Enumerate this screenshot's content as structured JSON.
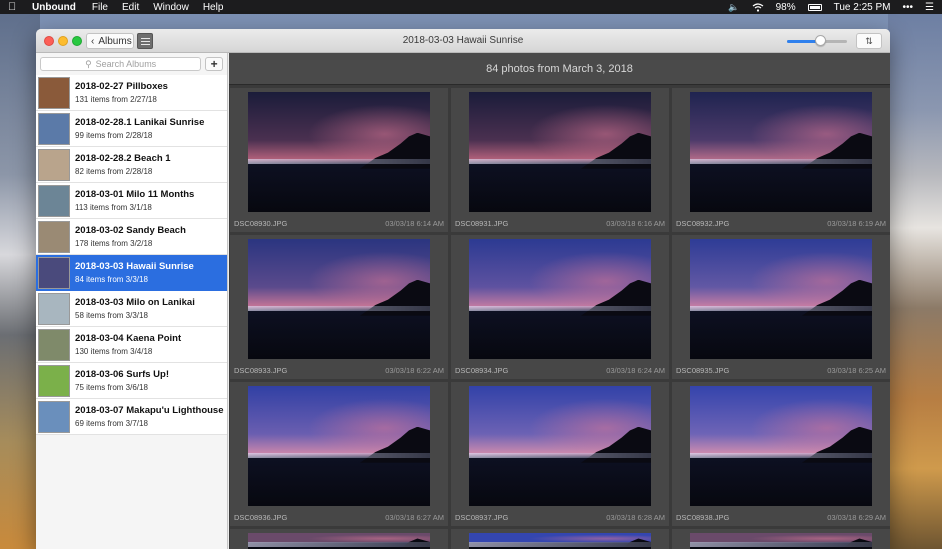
{
  "menubar": {
    "app_name": "Unbound",
    "menus": [
      "File",
      "Edit",
      "Window",
      "Help"
    ],
    "battery": "98%",
    "clock": "Tue 2:25 PM"
  },
  "window": {
    "title": "2018-03-03 Hawaii Sunrise",
    "back_label": "Albums"
  },
  "sidebar": {
    "search_placeholder": "Search Albums",
    "add_label": "+",
    "albums": [
      {
        "name": "2018-02-27 Pillboxes",
        "count": "131 items from 2/27/18",
        "thumb": "#8a5a3a"
      },
      {
        "name": "2018-02-28.1 Lanikai Sunrise",
        "count": "99 items from 2/28/18",
        "thumb": "#5b7aa8"
      },
      {
        "name": "2018-02-28.2 Beach 1",
        "count": "82 items from 2/28/18",
        "thumb": "#b9a48c"
      },
      {
        "name": "2018-03-01 Milo 11 Months",
        "count": "113 items from 3/1/18",
        "thumb": "#6c8596"
      },
      {
        "name": "2018-03-02 Sandy Beach",
        "count": "178 items from 3/2/18",
        "thumb": "#9a8a74"
      },
      {
        "name": "2018-03-03 Hawaii Sunrise",
        "count": "84 items from 3/3/18",
        "thumb": "#4a4a7c"
      },
      {
        "name": "2018-03-03 Milo on Lanikai",
        "count": "58 items from 3/3/18",
        "thumb": "#a8b6bf"
      },
      {
        "name": "2018-03-04 Kaena Point",
        "count": "130 items from 3/4/18",
        "thumb": "#7f8a6a"
      },
      {
        "name": "2018-03-06 Surfs Up!",
        "count": "75 items from 3/6/18",
        "thumb": "#7bb04a"
      },
      {
        "name": "2018-03-07 Makapu'u Lighthouse",
        "count": "69 items from 3/7/18",
        "thumb": "#6a8fbc"
      }
    ]
  },
  "content": {
    "header": "84 photos from March 3, 2018",
    "photos": [
      {
        "file": "DSC08930.JPG",
        "date": "03/03/18 6:14 AM",
        "top": "#1a1c3a",
        "mid": "#4a3050",
        "glow": "#b0607a"
      },
      {
        "file": "DSC08931.JPG",
        "date": "03/03/18 6:16 AM",
        "top": "#1a1c3a",
        "mid": "#4a3050",
        "glow": "#b0607a"
      },
      {
        "file": "DSC08932.JPG",
        "date": "03/03/18 6:19 AM",
        "top": "#1f2450",
        "mid": "#4c3a6a",
        "glow": "#b06a88"
      },
      {
        "file": "DSC08933.JPG",
        "date": "03/03/18 6:22 AM",
        "top": "#2a3580",
        "mid": "#5a4a8c",
        "glow": "#c27496"
      },
      {
        "file": "DSC08934.JPG",
        "date": "03/03/18 6:24 AM",
        "top": "#2c3a92",
        "mid": "#5e52a0",
        "glow": "#c07aa2"
      },
      {
        "file": "DSC08935.JPG",
        "date": "03/03/18 6:25 AM",
        "top": "#2e3c96",
        "mid": "#6258a4",
        "glow": "#c47ca4"
      },
      {
        "file": "DSC08936.JPG",
        "date": "03/03/18 6:27 AM",
        "top": "#3140a4",
        "mid": "#6a5eb0",
        "glow": "#c886ac"
      },
      {
        "file": "DSC08937.JPG",
        "date": "03/03/18 6:28 AM",
        "top": "#3242a8",
        "mid": "#6c62b4",
        "glow": "#ca8aae"
      },
      {
        "file": "DSC08938.JPG",
        "date": "03/03/18 6:29 AM",
        "top": "#3444ac",
        "mid": "#6e64b6",
        "glow": "#cc8cb0"
      },
      {
        "file": "",
        "date": "",
        "top": "#6a4a6a",
        "mid": "#6a4a6a",
        "glow": "#6a4a6a"
      },
      {
        "file": "",
        "date": "",
        "top": "#3446b0",
        "mid": "#3446b0",
        "glow": "#3446b0"
      },
      {
        "file": "",
        "date": "",
        "top": "#6a4a6a",
        "mid": "#6a4a6a",
        "glow": "#6a4a6a"
      }
    ]
  }
}
